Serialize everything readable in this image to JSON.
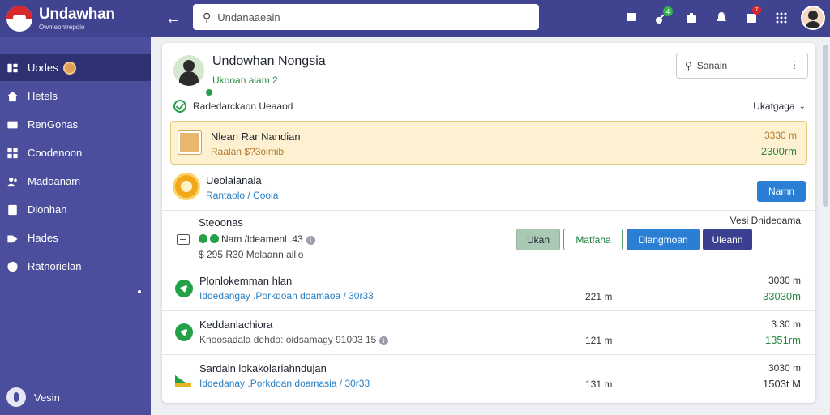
{
  "brand": {
    "title": "Undawhan",
    "subtitle": "Owmeohtrepdio"
  },
  "sidebar": {
    "items": [
      {
        "label": "Uodes",
        "icon": "dashboard-icon"
      },
      {
        "label": "Hetels",
        "icon": "home-icon"
      },
      {
        "label": "RenGonas",
        "icon": "card-icon"
      },
      {
        "label": "Coodenoon",
        "icon": "grid-icon"
      },
      {
        "label": "Madoanam",
        "icon": "people-icon"
      },
      {
        "label": "Dionhan",
        "icon": "document-icon"
      },
      {
        "label": "Hades",
        "icon": "tag-icon"
      },
      {
        "label": "Ratnorielan",
        "icon": "settings-icon"
      }
    ],
    "footer": "Vesin"
  },
  "topbar": {
    "search_placeholder": "Undanaaeain",
    "badge_green": "4",
    "badge_red": "7"
  },
  "profile": {
    "name": "Undowhan Nongsia",
    "status": "Ukooan aiam 2"
  },
  "card_search": {
    "placeholder": "Sanain",
    "more": "⋮"
  },
  "verified": {
    "label": "Radedarckaon Ueaaod"
  },
  "language": {
    "label": "Ukatgaga"
  },
  "highlight": {
    "title": "Nlean Rar Nandian",
    "subtitle": "Raalan $?3oimib",
    "value_top": "3330 m",
    "value_bottom": "2300rm"
  },
  "row_u": {
    "title": "Ueolaianaia",
    "subtitle": "Rantaolo / Cooia",
    "button": "Namn"
  },
  "section": {
    "title": "Steoonas",
    "meta": "Nam /ldeamenl .43",
    "price": "$ 295 R30 Molaann aillo",
    "right": "Vesi Dnideoama",
    "buttons": [
      "Ukan",
      "Matfaha",
      "Dlangmoan",
      "Uleann"
    ]
  },
  "items": [
    {
      "title": "Plonlokemman hlan",
      "subtitle": "Iddedangay .Porkdoan doamaoa / 30r33",
      "mid": "221 m",
      "v1": "3030 m",
      "v2": "33030m"
    },
    {
      "title": "Keddanlachiora",
      "subtitle": "Knoosadala dehdo: oidsamagy 91003 15",
      "mid": "121 m",
      "v1": "3.30 m",
      "v2": "1351rm"
    },
    {
      "title": "Sardaln lokakolariahndujan",
      "subtitle": "Iddedanay .Porkdoan doamasia / 30r33",
      "mid": "131 m",
      "v1": "3030 m",
      "v2": "1503t M"
    }
  ],
  "colors": {
    "sidebar": "#4a4e9c",
    "topbar": "#3f4390",
    "accent_blue": "#2a7fd4",
    "accent_green": "#24a148",
    "highlight_bg": "#fdf1d2"
  }
}
